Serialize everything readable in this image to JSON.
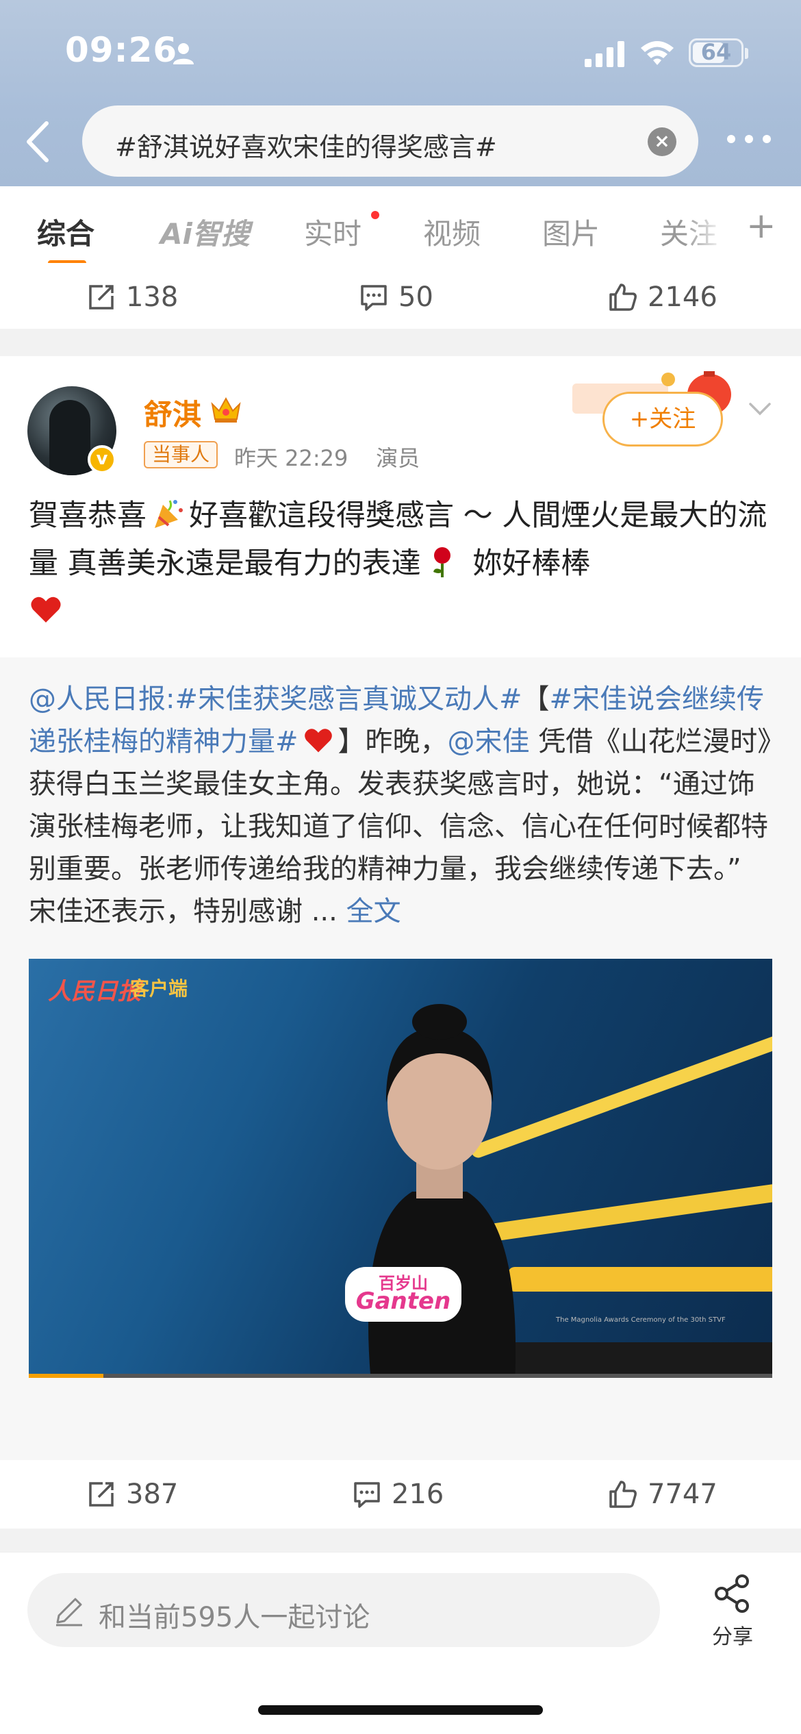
{
  "status_bar": {
    "time": "09:26",
    "battery": "64"
  },
  "search": {
    "query": "#舒淇说好喜欢宋佳的得奖感言#"
  },
  "tabs": [
    {
      "label": "综合"
    },
    {
      "label": "Ai智搜"
    },
    {
      "label": "实时"
    },
    {
      "label": "视频"
    },
    {
      "label": "图片"
    },
    {
      "label": "关注"
    }
  ],
  "prev_post_actions": {
    "reposts": "138",
    "comments": "50",
    "likes": "2146"
  },
  "post": {
    "author": "舒淇",
    "role_tag": "当事人",
    "time": "昨天 22:29",
    "occupation": "演员",
    "follow_label": "+关注",
    "text_a": "賀喜恭喜",
    "text_b": "好喜歡這段得獎感言 ～ 人間煙火是最大的流量 真善美永遠是最有力的表達",
    "text_c": "妳好棒棒",
    "repost": {
      "mention": "@人民日报",
      "topic1": ":#宋佳获奖感言真诚又动人#",
      "bracket_open": "【",
      "topic2": "#宋佳说会继续传递张桂梅的精神力量#",
      "bracket_close_text": "】昨晚，",
      "mention2": "@宋佳",
      "body": " 凭借《山花烂漫时》获得白玉兰奖最佳女主角。发表获奖感言时，她说：“通过饰演张桂梅老师，让我知道了信仰、信念、信心在任何时候都特别重要。张老师传递给我的精神力量，我会继续传递下去。”",
      "body2": "宋佳还表示，特别感谢 ... ",
      "more": "全文"
    },
    "video": {
      "watermark": "人民日报",
      "watermark_sub": "客户端",
      "sign_top": "百岁山",
      "sign_bottom": "Ganten",
      "caption": "The Magnolia Awards Ceremony of the 30th STVF",
      "progress": 0.1
    },
    "actions": {
      "reposts": "387",
      "comments": "216",
      "likes": "7747"
    }
  },
  "bottom": {
    "placeholder": "和当前595人一起讨论",
    "share_label": "分享"
  },
  "colors": {
    "accent": "#ff8200",
    "link": "#4a7ab8",
    "username": "#f07f00"
  }
}
